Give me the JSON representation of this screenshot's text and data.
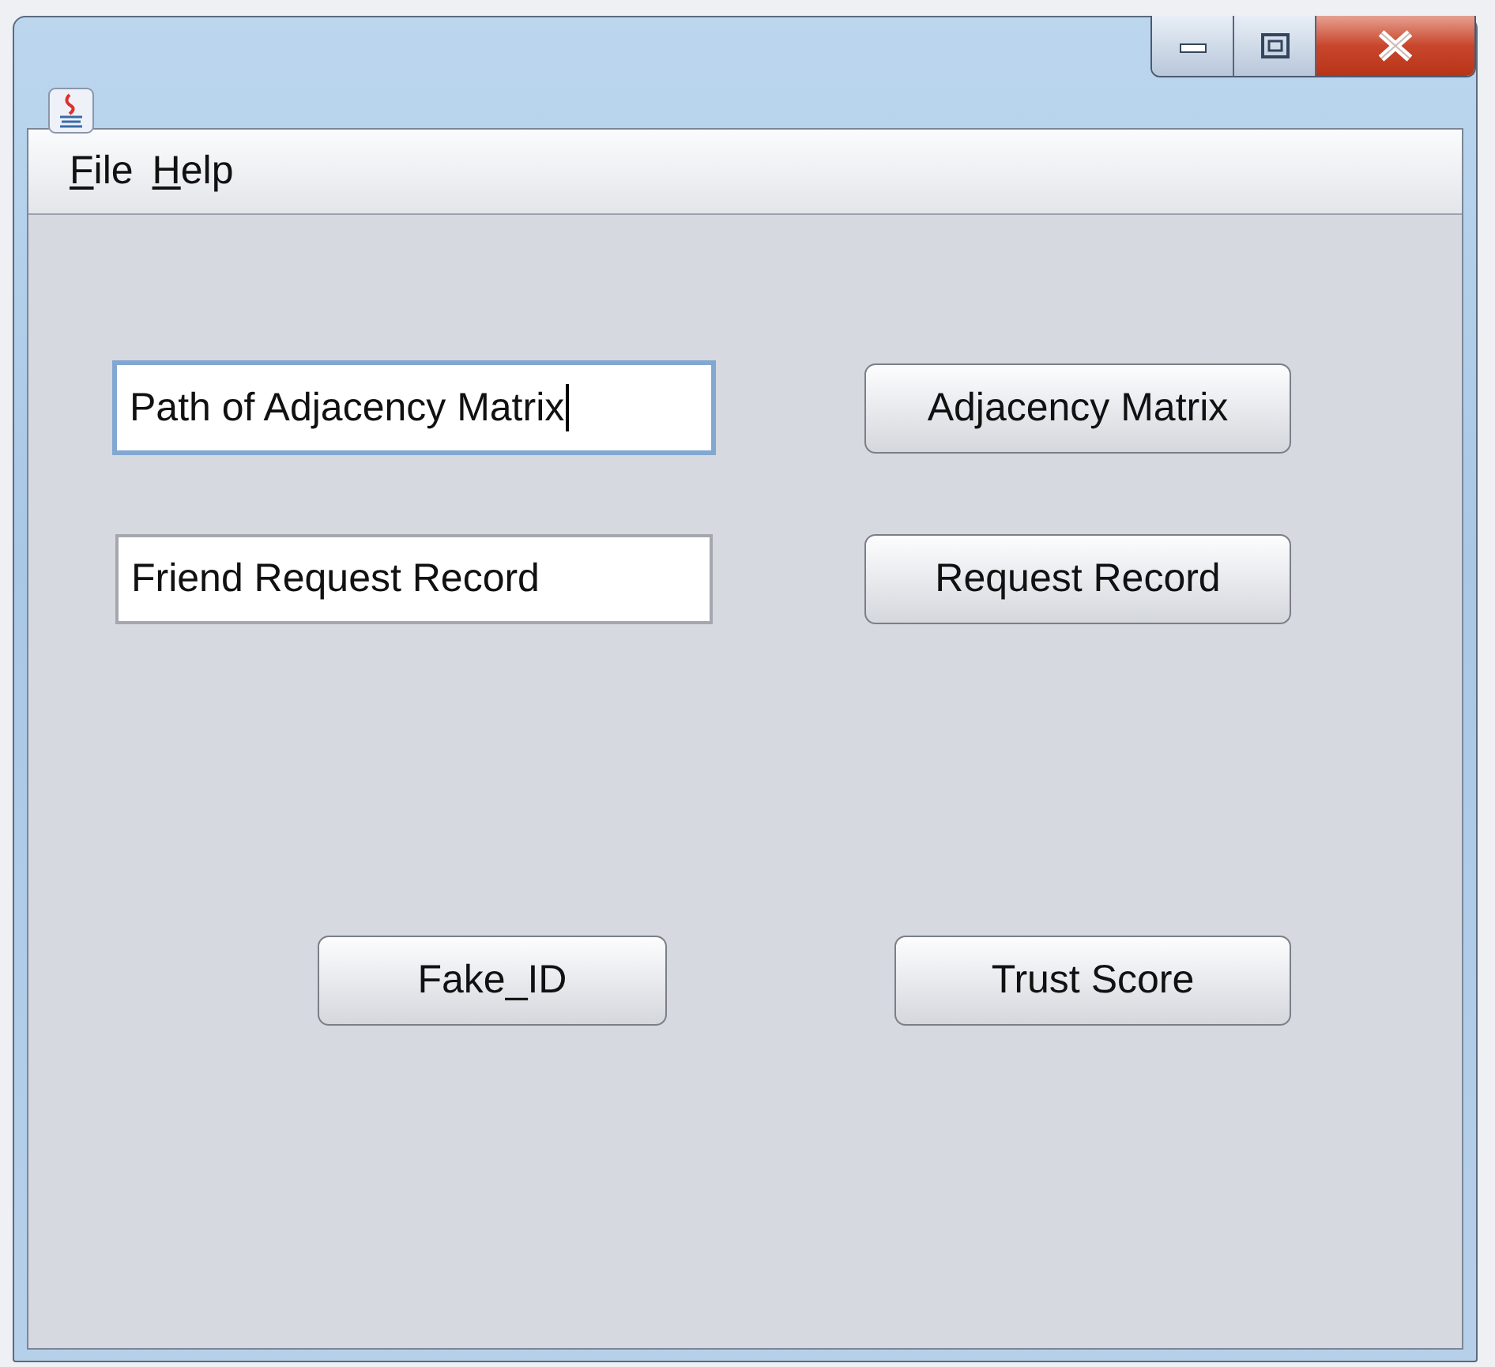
{
  "menu_bar": {
    "items": [
      {
        "label": "File"
      },
      {
        "label": "Help"
      }
    ]
  },
  "fields": [
    {
      "value": "Path of Adjacency Matrix",
      "focused": true
    },
    {
      "value": "Friend Request Record",
      "focused": false
    }
  ],
  "buttons": [
    {
      "label": "Adjacency Matrix"
    },
    {
      "label": "Request Record"
    },
    {
      "label": "Fake_ID"
    },
    {
      "label": "Trust Score"
    }
  ]
}
